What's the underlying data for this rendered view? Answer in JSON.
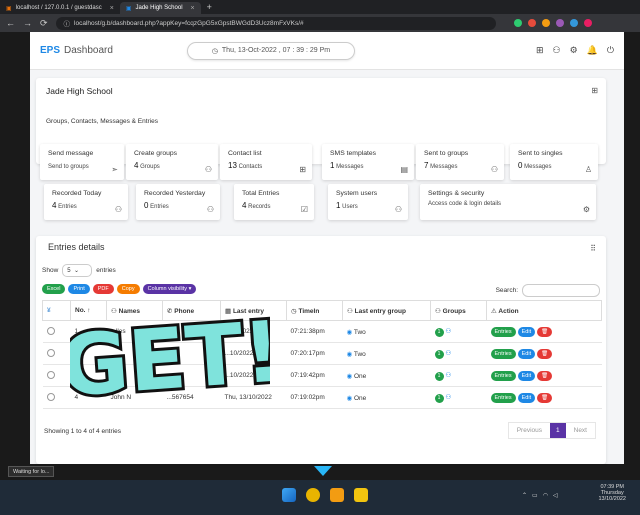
{
  "browser": {
    "tabs": [
      {
        "label": "localhost / 127.0.0.1 / guestdasc"
      },
      {
        "label": "Jade High School"
      }
    ],
    "url": "localhost/g.b/dashboard.php?appKey=fcqzGpG5xGpstBWGdD3Ucz8mFxVKs/#"
  },
  "header": {
    "logo": "EPS",
    "title": "Dashboard",
    "datetime": "Thu, 13-Oct-2022 , 07 : 39 : 29 Pm"
  },
  "school": {
    "name": "Jade High School",
    "subtitle": "Groups, Contacts, Messages & Entries"
  },
  "stats": [
    {
      "title": "Send message",
      "value": "",
      "unit": "Send to groups",
      "icon": "send-icon"
    },
    {
      "title": "Create groups",
      "value": "4",
      "unit": "Groups",
      "icon": "group-icon"
    },
    {
      "title": "Contact list",
      "value": "13",
      "unit": "Contacts",
      "icon": "contacts-icon"
    },
    {
      "title": "SMS templates",
      "value": "1",
      "unit": "Messages",
      "icon": "template-icon"
    },
    {
      "title": "Sent to groups",
      "value": "7",
      "unit": "Messages",
      "icon": "group-icon"
    },
    {
      "title": "Sent to singles",
      "value": "0",
      "unit": "Messages",
      "icon": "user-icon"
    },
    {
      "title": "Recorded Today",
      "value": "4",
      "unit": "Entries",
      "icon": "user-add-icon"
    },
    {
      "title": "Recorded Yesterday",
      "value": "0",
      "unit": "Entries",
      "icon": "user-add-icon"
    },
    {
      "title": "Total Entries",
      "value": "4",
      "unit": "Records",
      "icon": "check-icon"
    },
    {
      "title": "System users",
      "value": "1",
      "unit": "Users",
      "icon": "user-add-icon"
    },
    {
      "title": "Settings & security",
      "value": "",
      "unit": "Access code & login details",
      "icon": "gear-icon"
    }
  ],
  "entries": {
    "title": "Entries details",
    "show_label": "Show",
    "length": "5",
    "entries_label": "entries",
    "search_label": "Search:",
    "buttons": [
      "Excel",
      "Print",
      "PDF",
      "Copy",
      "Column visibility"
    ],
    "columns": [
      "No.",
      "Names",
      "Phone",
      "Last entry",
      "TimeIn",
      "Last entry group",
      "Groups",
      "Action"
    ],
    "rows": [
      {
        "no": "1",
        "name": "...lles",
        "phone": "",
        "last": "...10/2022",
        "timein": "07:21:38pm",
        "group": "Two",
        "groups": "1"
      },
      {
        "no": "2",
        "name": "",
        "phone": "",
        "last": "...10/2022",
        "timein": "07:20:17pm",
        "group": "Two",
        "groups": "1"
      },
      {
        "no": "3",
        "name": "",
        "phone": "",
        "last": "...10/2022",
        "timein": "07:19:42pm",
        "group": "One",
        "groups": "1"
      },
      {
        "no": "4",
        "name": "John N",
        "phone": "...567654",
        "last": "Thu, 13/10/2022",
        "timein": "07:19:02pm",
        "group": "One",
        "groups": "1"
      }
    ],
    "row_actions": {
      "entries": "Entries",
      "edit": "Edit"
    },
    "showing": "Showing 1 to 4 of 4 entries",
    "pager": {
      "prev": "Previous",
      "current": "1",
      "next": "Next"
    }
  },
  "overlay_text": "GET!",
  "status_tip": "Waiting for lo...",
  "tray": {
    "time": "07:39 PM",
    "day": "Thursday",
    "date": "13/10/2022"
  }
}
